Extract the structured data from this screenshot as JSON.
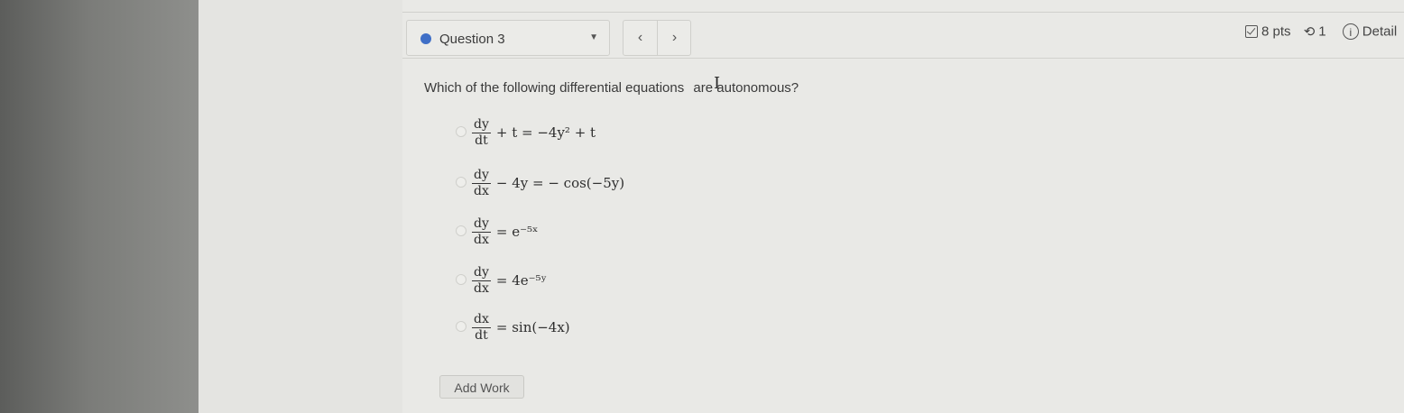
{
  "header": {
    "question_label": "Question 3",
    "prev_label": "‹",
    "next_label": "›",
    "points": "8 pts",
    "attempts": "1",
    "details_label": "Detail"
  },
  "question": {
    "prompt_before_cursor": "Which of the following differential equations",
    "prompt_after_cursor": "are autonomous?",
    "options": [
      {
        "num": "dy",
        "den": "dt",
        "rest": "+ t = −4y² + t"
      },
      {
        "num": "dy",
        "den": "dx",
        "rest": "− 4y = − cos(−5y)"
      },
      {
        "num": "dy",
        "den": "dx",
        "rest": "= e⁻⁵ˣ"
      },
      {
        "num": "dy",
        "den": "dx",
        "rest": "= 4e⁻⁵ʸ"
      },
      {
        "num": "dx",
        "den": "dt",
        "rest": "= sin(−4x)"
      }
    ]
  },
  "actions": {
    "add_work_label": "Add Work"
  },
  "colors": {
    "question_dot": "#3f6fc7"
  }
}
